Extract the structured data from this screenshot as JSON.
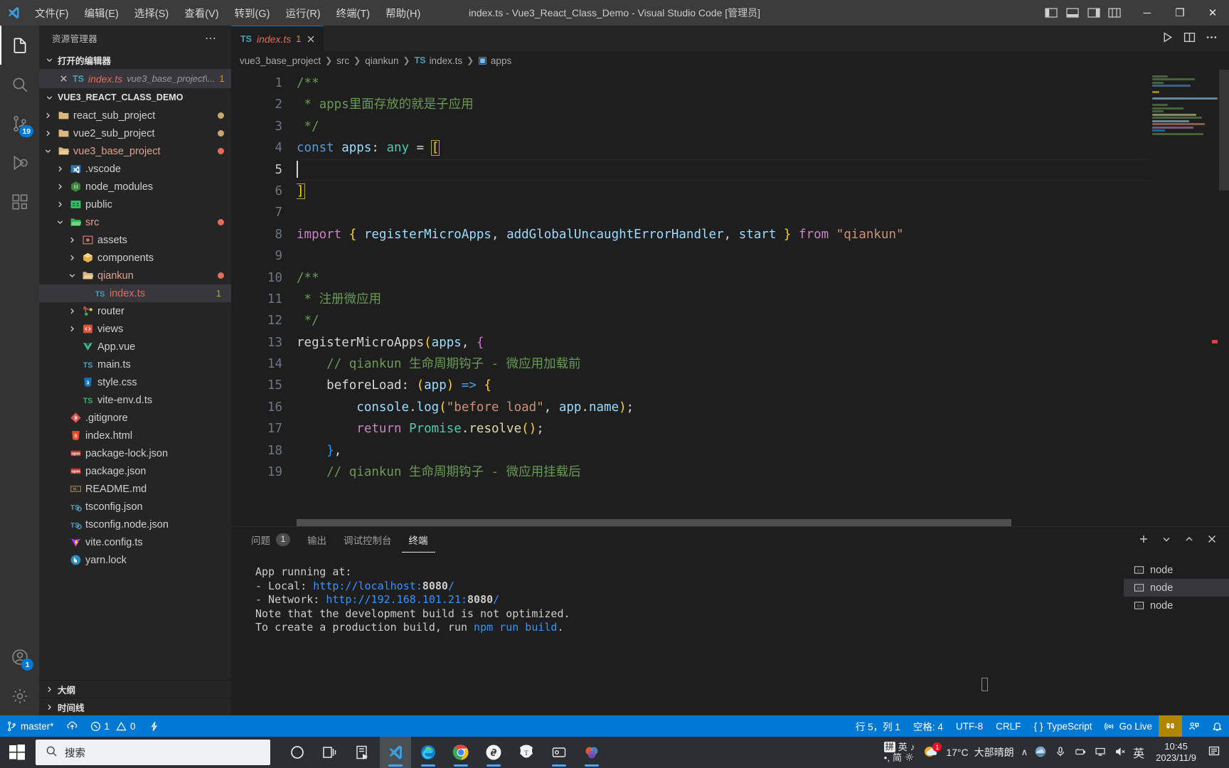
{
  "titlebar": {
    "logo_icon": "vscode-logo-icon",
    "menus": [
      {
        "label": "文件(F)",
        "name": "menu-file"
      },
      {
        "label": "编辑(E)",
        "name": "menu-edit"
      },
      {
        "label": "选择(S)",
        "name": "menu-selection"
      },
      {
        "label": "查看(V)",
        "name": "menu-view"
      },
      {
        "label": "转到(G)",
        "name": "menu-go"
      },
      {
        "label": "运行(R)",
        "name": "menu-run"
      },
      {
        "label": "终端(T)",
        "name": "menu-terminal"
      },
      {
        "label": "帮助(H)",
        "name": "menu-help"
      }
    ],
    "window_title": "index.ts - Vue3_React_Class_Demo - Visual Studio Code [管理员]",
    "minimize": "─",
    "maximize": "❐",
    "close": "✕"
  },
  "activitybar": {
    "items": [
      {
        "name": "activity-explorer",
        "icon": "files-icon",
        "badge": ""
      },
      {
        "name": "activity-search",
        "icon": "search-icon",
        "badge": ""
      },
      {
        "name": "activity-source-control",
        "icon": "source-control-icon",
        "badge": "19"
      },
      {
        "name": "activity-run-debug",
        "icon": "debug-icon",
        "badge": ""
      },
      {
        "name": "activity-extensions",
        "icon": "extensions-icon",
        "badge": ""
      }
    ],
    "account_badge": "1",
    "account_icon": "account-icon",
    "settings_icon": "gear-icon"
  },
  "sidebar": {
    "title": "资源管理器",
    "more_actions": "⋯",
    "open_editors": {
      "header": "打开的编辑器",
      "items": [
        {
          "name": "index.ts",
          "path": "vue3_base_project\\...",
          "badge": "1",
          "icon": "ts-file-icon"
        }
      ]
    },
    "project": {
      "header": "VUE3_REACT_CLASS_DEMO",
      "files": [
        {
          "label": "react_sub_project",
          "indent": 1,
          "type": "folder",
          "icon": "folder-icon",
          "expanded": false,
          "dot": "#c9a86c"
        },
        {
          "label": "vue2_sub_project",
          "indent": 1,
          "type": "folder",
          "icon": "folder-icon",
          "expanded": false,
          "dot": "#c9a86c"
        },
        {
          "label": "vue3_base_project",
          "indent": 1,
          "type": "folder-open",
          "icon": "folder-open-icon",
          "expanded": true,
          "dot": "#e06c5a",
          "modified": true
        },
        {
          "label": ".vscode",
          "indent": 2,
          "type": "folder",
          "icon": "vscode-folder-icon",
          "expanded": false,
          "dot": ""
        },
        {
          "label": "node_modules",
          "indent": 2,
          "type": "folder",
          "icon": "node-folder-icon",
          "expanded": false,
          "dot": ""
        },
        {
          "label": "public",
          "indent": 2,
          "type": "folder",
          "icon": "public-folder-icon",
          "expanded": false,
          "dot": ""
        },
        {
          "label": "src",
          "indent": 2,
          "type": "folder-open",
          "icon": "src-folder-icon",
          "expanded": true,
          "dot": "#e06c5a",
          "modified": true
        },
        {
          "label": "assets",
          "indent": 3,
          "type": "folder",
          "icon": "assets-folder-icon",
          "expanded": false,
          "dot": ""
        },
        {
          "label": "components",
          "indent": 3,
          "type": "folder",
          "icon": "components-folder-icon",
          "expanded": false,
          "dot": ""
        },
        {
          "label": "qiankun",
          "indent": 3,
          "type": "folder-open",
          "icon": "folder-open-icon",
          "expanded": true,
          "dot": "#e06c5a",
          "modified": true
        },
        {
          "label": "index.ts",
          "indent": 4,
          "type": "file",
          "icon": "ts-file-icon",
          "selected": true,
          "badge": "1",
          "error": true
        },
        {
          "label": "router",
          "indent": 3,
          "type": "folder",
          "icon": "router-folder-icon",
          "expanded": false,
          "dot": ""
        },
        {
          "label": "views",
          "indent": 3,
          "type": "folder",
          "icon": "views-folder-icon",
          "expanded": false,
          "dot": ""
        },
        {
          "label": "App.vue",
          "indent": 3,
          "type": "file",
          "icon": "vue-file-icon",
          "dot": ""
        },
        {
          "label": "main.ts",
          "indent": 3,
          "type": "file",
          "icon": "ts-file-icon",
          "dot": ""
        },
        {
          "label": "style.css",
          "indent": 3,
          "type": "file",
          "icon": "css-file-icon",
          "dot": ""
        },
        {
          "label": "vite-env.d.ts",
          "indent": 3,
          "type": "file",
          "icon": "dts-file-icon",
          "dot": ""
        },
        {
          "label": ".gitignore",
          "indent": 2,
          "type": "file",
          "icon": "git-file-icon",
          "dot": ""
        },
        {
          "label": "index.html",
          "indent": 2,
          "type": "file",
          "icon": "html-file-icon",
          "dot": ""
        },
        {
          "label": "package-lock.json",
          "indent": 2,
          "type": "file",
          "icon": "npm-file-icon",
          "dot": ""
        },
        {
          "label": "package.json",
          "indent": 2,
          "type": "file",
          "icon": "npm-file-icon",
          "dot": ""
        },
        {
          "label": "README.md",
          "indent": 2,
          "type": "file",
          "icon": "markdown-file-icon",
          "dot": ""
        },
        {
          "label": "tsconfig.json",
          "indent": 2,
          "type": "file",
          "icon": "tsconfig-file-icon",
          "dot": ""
        },
        {
          "label": "tsconfig.node.json",
          "indent": 2,
          "type": "file",
          "icon": "tsconfig-file-icon",
          "dot": ""
        },
        {
          "label": "vite.config.ts",
          "indent": 2,
          "type": "file",
          "icon": "vite-file-icon",
          "dot": ""
        },
        {
          "label": "yarn.lock",
          "indent": 2,
          "type": "file",
          "icon": "yarn-file-icon",
          "dot": ""
        }
      ]
    },
    "bottom_sections": [
      {
        "label": "大纲",
        "name": "sidebar-section-outline"
      },
      {
        "label": "时间线",
        "name": "sidebar-section-timeline"
      }
    ]
  },
  "editor": {
    "tab": {
      "name": "index.ts",
      "badge": "1",
      "icon": "ts-file-icon",
      "close": "✕"
    },
    "breadcrumb": [
      "vue3_base_project",
      "src",
      "qiankun",
      "index.ts",
      "apps"
    ],
    "actions": [
      "run-icon",
      "split-editor-icon",
      "more-actions-icon"
    ],
    "lines": [
      {
        "n": 1,
        "tokens": [
          {
            "t": "/**",
            "c": "k-comment"
          }
        ]
      },
      {
        "n": 2,
        "tokens": [
          {
            "t": " * apps里面存放的就是子应用",
            "c": "k-comment"
          }
        ]
      },
      {
        "n": 3,
        "tokens": [
          {
            "t": " */",
            "c": "k-comment"
          }
        ]
      },
      {
        "n": 4,
        "tokens": [
          {
            "t": "const",
            "c": "k-keyword"
          },
          {
            "t": " ",
            "c": "k-op"
          },
          {
            "t": "apps",
            "c": "k-var"
          },
          {
            "t": ": ",
            "c": "k-op"
          },
          {
            "t": "any",
            "c": "k-type"
          },
          {
            "t": " = ",
            "c": "k-op"
          },
          {
            "t": "[",
            "c": "k-p1 bracket-hl"
          }
        ]
      },
      {
        "n": 5,
        "tokens": [],
        "cursor": true
      },
      {
        "n": 6,
        "tokens": [
          {
            "t": "]",
            "c": "k-p1 bracket-hl"
          }
        ]
      },
      {
        "n": 7,
        "tokens": []
      },
      {
        "n": 8,
        "tokens": [
          {
            "t": "import",
            "c": "k-kw2"
          },
          {
            "t": " ",
            "c": "k-op"
          },
          {
            "t": "{",
            "c": "k-p1"
          },
          {
            "t": " ",
            "c": "k-op"
          },
          {
            "t": "registerMicroApps",
            "c": "k-var"
          },
          {
            "t": ", ",
            "c": "k-op"
          },
          {
            "t": "addGlobalUncaughtErrorHandler",
            "c": "k-var"
          },
          {
            "t": ", ",
            "c": "k-op"
          },
          {
            "t": "start",
            "c": "k-var"
          },
          {
            "t": " ",
            "c": "k-op"
          },
          {
            "t": "}",
            "c": "k-p1"
          },
          {
            "t": " ",
            "c": "k-op"
          },
          {
            "t": "from",
            "c": "k-kw2"
          },
          {
            "t": " ",
            "c": "k-op"
          },
          {
            "t": "\"qiankun\"",
            "c": "k-str"
          }
        ]
      },
      {
        "n": 9,
        "tokens": []
      },
      {
        "n": 10,
        "tokens": [
          {
            "t": "/**",
            "c": "k-comment"
          }
        ]
      },
      {
        "n": 11,
        "tokens": [
          {
            "t": " * 注册微应用",
            "c": "k-comment"
          }
        ]
      },
      {
        "n": 12,
        "tokens": [
          {
            "t": " */",
            "c": "k-comment"
          }
        ]
      },
      {
        "n": 13,
        "tokens": [
          {
            "t": "registerMicroApps",
            "c": "k-op"
          },
          {
            "t": "(",
            "c": "k-p1"
          },
          {
            "t": "apps",
            "c": "k-var"
          },
          {
            "t": ", ",
            "c": "k-op"
          },
          {
            "t": "{",
            "c": "k-p2"
          }
        ]
      },
      {
        "n": 14,
        "tokens": [
          {
            "t": "    // qiankun 生命周期钩子 - 微应用加载前",
            "c": "k-comment"
          }
        ]
      },
      {
        "n": 15,
        "tokens": [
          {
            "t": "    ",
            "c": "k-op"
          },
          {
            "t": "beforeLoad",
            "c": "k-op"
          },
          {
            "t": ": ",
            "c": "k-op"
          },
          {
            "t": "(",
            "c": "k-p1"
          },
          {
            "t": "app",
            "c": "k-var"
          },
          {
            "t": ")",
            "c": "k-p1"
          },
          {
            "t": " => ",
            "c": "k-keyword"
          },
          {
            "t": "{",
            "c": "k-p1"
          }
        ]
      },
      {
        "n": 16,
        "tokens": [
          {
            "t": "        ",
            "c": "k-op"
          },
          {
            "t": "console",
            "c": "k-var"
          },
          {
            "t": ".",
            "c": "k-op"
          },
          {
            "t": "log",
            "c": "k-var"
          },
          {
            "t": "(",
            "c": "k-p1"
          },
          {
            "t": "\"before load\"",
            "c": "k-str"
          },
          {
            "t": ", ",
            "c": "k-op"
          },
          {
            "t": "app",
            "c": "k-var"
          },
          {
            "t": ".",
            "c": "k-op"
          },
          {
            "t": "name",
            "c": "k-var"
          },
          {
            "t": ")",
            "c": "k-p1"
          },
          {
            "t": ";",
            "c": "k-op"
          }
        ]
      },
      {
        "n": 17,
        "tokens": [
          {
            "t": "        ",
            "c": "k-op"
          },
          {
            "t": "return",
            "c": "k-kw2"
          },
          {
            "t": " ",
            "c": "k-op"
          },
          {
            "t": "Promise",
            "c": "k-type"
          },
          {
            "t": ".",
            "c": "k-op"
          },
          {
            "t": "resolve",
            "c": "k-func"
          },
          {
            "t": "(",
            "c": "k-p1"
          },
          {
            "t": ")",
            "c": "k-p1"
          },
          {
            "t": ";",
            "c": "k-op"
          }
        ]
      },
      {
        "n": 18,
        "tokens": [
          {
            "t": "    ",
            "c": "k-op"
          },
          {
            "t": "}",
            "c": "k-p3"
          },
          {
            "t": ",",
            "c": "k-op"
          }
        ]
      },
      {
        "n": 19,
        "tokens": [
          {
            "t": "    // qiankun 生命周期钩子 - 微应用挂载后",
            "c": "k-comment"
          }
        ]
      }
    ]
  },
  "panel": {
    "tabs": [
      {
        "label": "问题",
        "count": "1",
        "name": "panel-tab-problems",
        "active": false
      },
      {
        "label": "输出",
        "count": "",
        "name": "panel-tab-output",
        "active": false
      },
      {
        "label": "调试控制台",
        "count": "",
        "name": "panel-tab-debug-console",
        "active": false
      },
      {
        "label": "终端",
        "count": "",
        "name": "panel-tab-terminal",
        "active": true
      }
    ],
    "actions": [
      "add-terminal-icon",
      "terminal-dropdown-icon",
      "maximize-panel-icon",
      "close-panel-icon"
    ],
    "terminal_output": [
      {
        "segs": [
          {
            "t": "App running at:",
            "c": ""
          }
        ]
      },
      {
        "segs": [
          {
            "t": "- Local:   ",
            "c": ""
          },
          {
            "t": "http://localhost:",
            "c": "t-link"
          },
          {
            "t": "8080",
            "c": "t-link t-bold"
          },
          {
            "t": "/",
            "c": "t-link"
          }
        ]
      },
      {
        "segs": [
          {
            "t": "- Network: ",
            "c": ""
          },
          {
            "t": "http://192.168.101.21:",
            "c": "t-link"
          },
          {
            "t": "8080",
            "c": "t-link t-bold"
          },
          {
            "t": "/",
            "c": "t-link"
          }
        ]
      },
      {
        "segs": [
          {
            "t": " ",
            "c": ""
          }
        ]
      },
      {
        "segs": [
          {
            "t": "Note that the development build is not optimized.",
            "c": ""
          }
        ]
      },
      {
        "segs": [
          {
            "t": "To create a production build, run ",
            "c": ""
          },
          {
            "t": "npm run build",
            "c": "t-cmd"
          },
          {
            "t": ".",
            "c": ""
          }
        ]
      }
    ],
    "terminals": [
      {
        "label": "node",
        "icon": "terminal-icon",
        "active": false
      },
      {
        "label": "node",
        "icon": "terminal-icon",
        "active": true
      },
      {
        "label": "node",
        "icon": "terminal-icon",
        "active": false
      }
    ]
  },
  "statusbar": {
    "left": [
      {
        "label": "master*",
        "icon": "source-control-icon",
        "name": "status-branch"
      },
      {
        "label": "",
        "icon": "sync-icon",
        "name": "status-sync"
      },
      {
        "label": "1",
        "icon": "error-icon",
        "label2": "0",
        "icon2": "warning-icon",
        "name": "status-problems"
      },
      {
        "label": "",
        "icon": "ports-icon",
        "name": "status-ports"
      }
    ],
    "right": [
      {
        "label": "行 5，列 1",
        "name": "status-cursor-position"
      },
      {
        "label": "空格: 4",
        "name": "status-indentation"
      },
      {
        "label": "UTF-8",
        "name": "status-encoding"
      },
      {
        "label": "CRLF",
        "name": "status-eol"
      },
      {
        "label": "TypeScript",
        "icon": "braces-icon",
        "name": "status-language-mode"
      },
      {
        "label": "Go Live",
        "icon": "broadcast-icon",
        "name": "status-go-live"
      },
      {
        "label": "",
        "icon": "live-share-icon",
        "name": "status-live-share",
        "highlight": "#b08500"
      },
      {
        "label": "",
        "icon": "feedback-icon",
        "name": "status-feedback"
      },
      {
        "label": "",
        "icon": "bell-icon",
        "name": "status-notifications"
      }
    ]
  },
  "taskbar": {
    "start_icon": "windows-start-icon",
    "search_placeholder": "搜索",
    "search_icon": "search-icon",
    "apps": [
      {
        "name": "taskbar-cortana",
        "icon": "circle-icon"
      },
      {
        "name": "taskbar-task-view",
        "icon": "task-view-icon"
      },
      {
        "name": "taskbar-notes",
        "icon": "notes-icon"
      },
      {
        "name": "taskbar-vscode",
        "icon": "vscode-icon",
        "active": true
      },
      {
        "name": "taskbar-edge",
        "icon": "edge-icon",
        "running": true
      },
      {
        "name": "taskbar-chrome",
        "icon": "chrome-icon",
        "running": true
      },
      {
        "name": "taskbar-link",
        "icon": "link-icon",
        "running": true
      },
      {
        "name": "taskbar-typora",
        "icon": "typora-icon",
        "running": false
      },
      {
        "name": "taskbar-app8",
        "icon": "window-icon",
        "running": true
      },
      {
        "name": "taskbar-app9",
        "icon": "colorful-icon",
        "running": true
      }
    ],
    "ime": {
      "top_left": "拼",
      "top_mid": "英",
      "top_right": "♪",
      "bottom_left": "•,",
      "bottom_mid": "简",
      "bottom_right": "gear-icon"
    },
    "weather": {
      "temp": "17°C",
      "desc": "大部晴朗",
      "icon": "partly-cloudy-icon",
      "badge": "1"
    },
    "chevron": "∧",
    "tray_icons": [
      "onedrive-icon",
      "microphone-icon",
      "battery-icon",
      "network-icon",
      "volume-mute-icon"
    ],
    "ime_tray": "英",
    "time": "10:45",
    "date": "2023/11/9",
    "action_center_icon": "action-center-icon"
  }
}
